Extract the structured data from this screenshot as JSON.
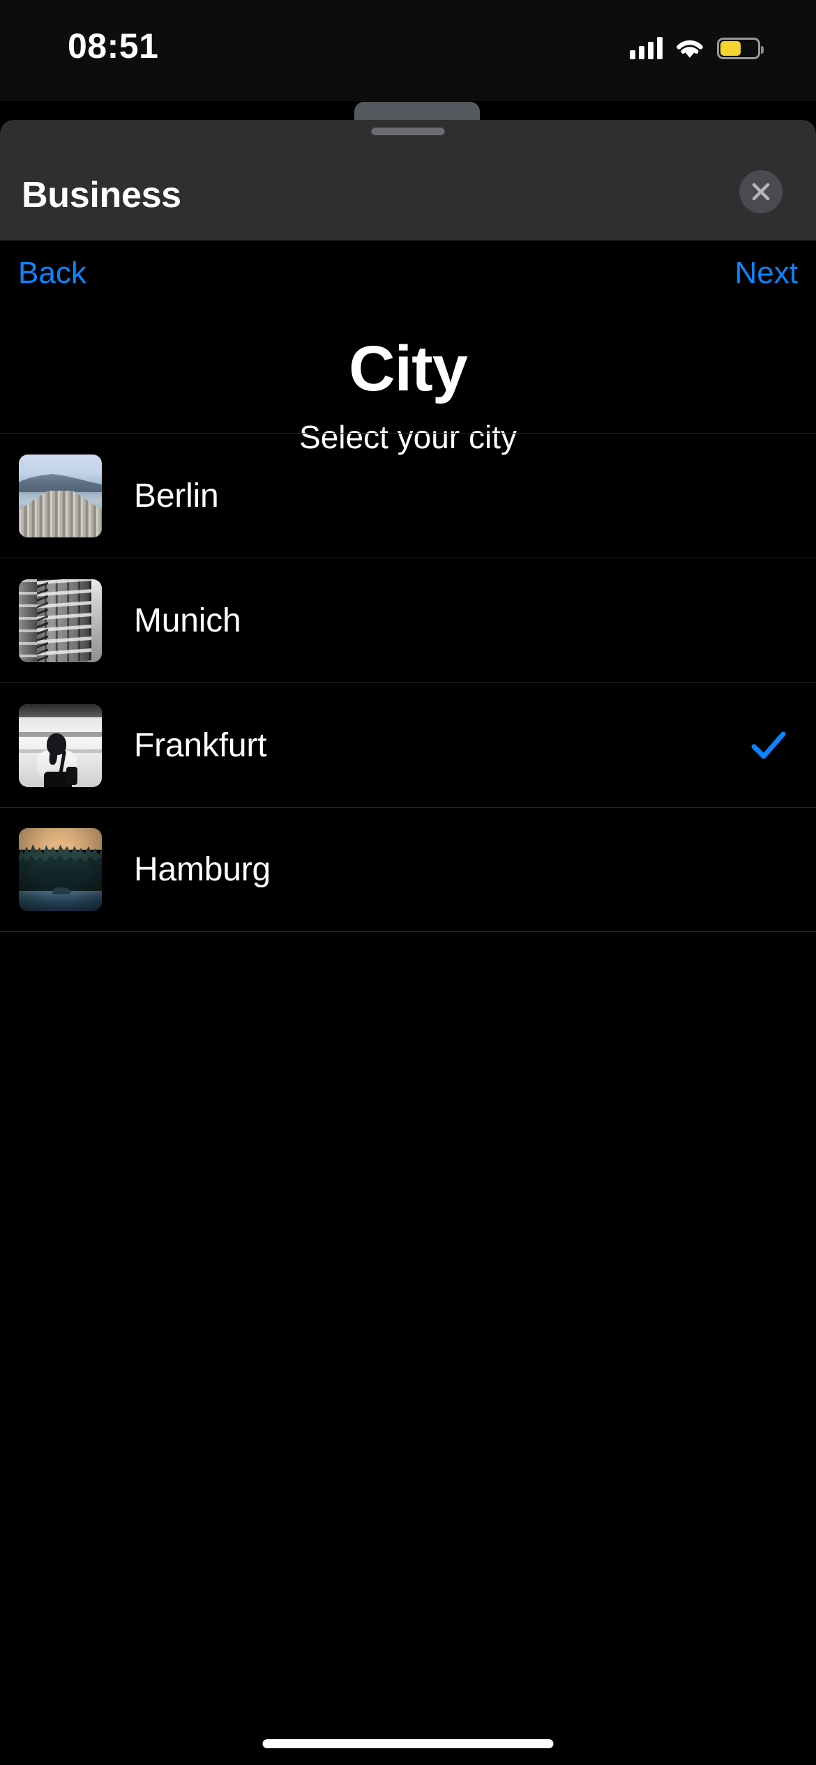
{
  "status_bar": {
    "time": "08:51",
    "cellular_icon": "cellular-bars-icon",
    "wifi_icon": "wifi-icon",
    "battery_icon": "battery-icon",
    "battery_color": "#F5D331",
    "battery_level_percent": 52
  },
  "sheet": {
    "title": "Business",
    "close_icon": "close-icon",
    "grabber": "sheet-grabber"
  },
  "nav": {
    "back_label": "Back",
    "next_label": "Next",
    "accent_color": "#0A84FF"
  },
  "hero": {
    "title": "City",
    "subtitle": "Select your city"
  },
  "list": {
    "selected_city": "Frankfurt",
    "check_icon": "checkmark-icon",
    "check_color": "#0A84FF",
    "items": [
      {
        "name": "Berlin",
        "thumbnail": "lake-dock-photo",
        "selected": false
      },
      {
        "name": "Munich",
        "thumbnail": "building-facade-photo",
        "selected": false
      },
      {
        "name": "Frankfurt",
        "thumbnail": "train-platform-photo",
        "selected": true
      },
      {
        "name": "Hamburg",
        "thumbnail": "dusk-forest-photo",
        "selected": false
      }
    ]
  },
  "home_indicator": "home-indicator"
}
